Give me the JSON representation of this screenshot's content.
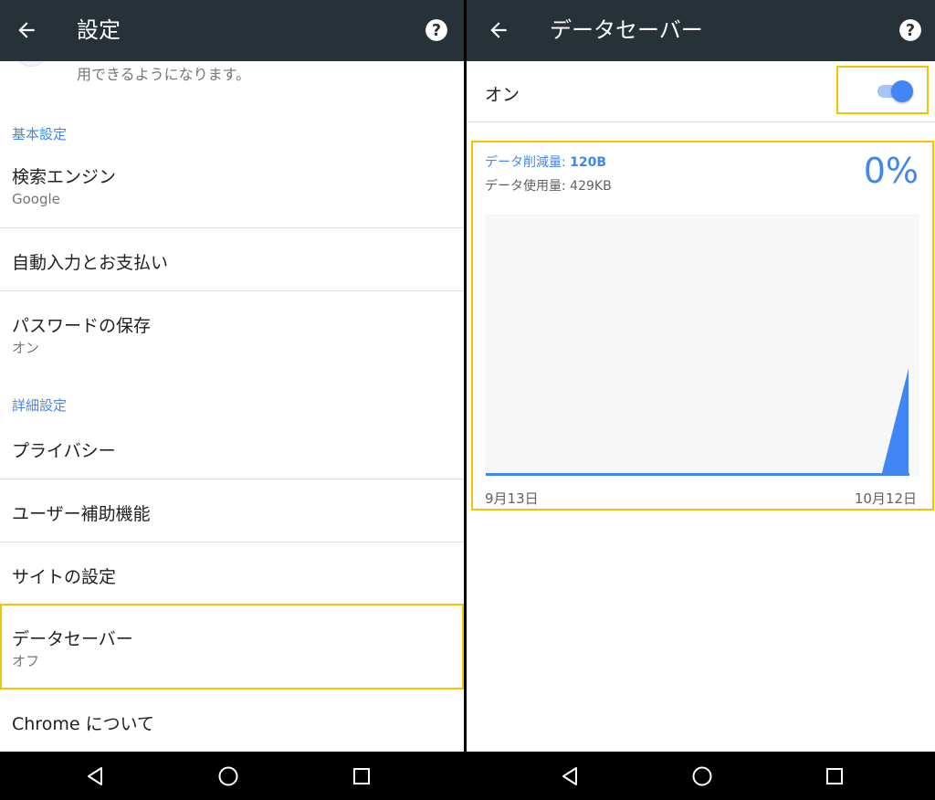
{
  "left": {
    "toolbar": {
      "title": "設定"
    },
    "truncated_text": "用できるようになります。",
    "sections": {
      "basic_header": "基本設定",
      "advanced_header": "詳細設定"
    },
    "items": [
      {
        "title": "検索エンジン",
        "subtitle": "Google"
      },
      {
        "title": "自動入力とお支払い"
      },
      {
        "title": "パスワードの保存",
        "subtitle": "オン"
      },
      {
        "title": "プライバシー"
      },
      {
        "title": "ユーザー補助機能"
      },
      {
        "title": "サイトの設定"
      },
      {
        "title": "データセーバー",
        "subtitle": "オフ"
      },
      {
        "title": "Chrome について"
      }
    ]
  },
  "right": {
    "toolbar": {
      "title": "データセーバー"
    },
    "toggle": {
      "label": "オン",
      "state": "on"
    },
    "stats": {
      "saved_label": "データ削減量: ",
      "saved_value": "120B",
      "used_text": "データ使用量: 429KB",
      "percent": "0%"
    },
    "chart_data": {
      "type": "area",
      "x_start_label": "9月13日",
      "x_end_label": "10月12日",
      "values": [
        0,
        0,
        0,
        0,
        0,
        0,
        0,
        0,
        0,
        0,
        0,
        0,
        0,
        0,
        0,
        0,
        0,
        0,
        0,
        0,
        0,
        0,
        0,
        0,
        0,
        0,
        0,
        0,
        0,
        0.4
      ],
      "color": "#4285f4"
    }
  },
  "icons": {
    "back": "arrow-left-icon",
    "help": "help-circle-icon",
    "nav_back": "triangle-back-icon",
    "nav_home": "circle-home-icon",
    "nav_recents": "square-recents-icon"
  },
  "colors": {
    "toolbar": "#263238",
    "accent": "#4285f4",
    "highlight": "#f5c400"
  }
}
